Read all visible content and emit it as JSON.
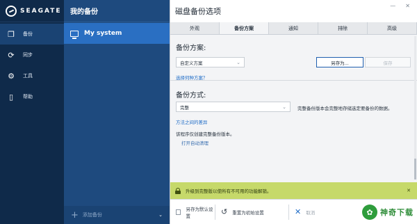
{
  "brand": {
    "name": "SEAGATE"
  },
  "sidebar": {
    "items": [
      {
        "label": "备份",
        "icon": "copy-icon",
        "active": true
      },
      {
        "label": "同步",
        "icon": "sync-icon",
        "active": false
      },
      {
        "label": "工具",
        "icon": "tools-icon",
        "active": false
      },
      {
        "label": "帮助",
        "icon": "book-icon",
        "active": false
      }
    ]
  },
  "backups": {
    "header": "我的备份",
    "items": [
      {
        "label": "My system"
      }
    ],
    "add_label": "添加备份"
  },
  "dialog": {
    "title": "磁盘备份选项",
    "tabs": [
      "外观",
      "备份方案",
      "通知",
      "排除",
      "高级"
    ],
    "active_tab": "备份方案",
    "scheme": {
      "title": "备份方案:",
      "selected": "自定义方案",
      "save_as_label": "另存为...",
      "save_label": "保存",
      "choose_link": "选择何种方案？"
    },
    "method": {
      "title": "备份方式:",
      "selected": "完整",
      "description": "完整备份版本会完整地存储选定要备份的数据。",
      "diff_link": "方法之间的差异",
      "note": "该程序仅创建完整备份版本。",
      "cleanup_link": "打开自动清理"
    },
    "upgrade": {
      "text": "升级到完整版以使所有不可用的功能解锁。",
      "close": "✕"
    },
    "bottom": {
      "save_default_label": "另存为默认设置",
      "reset_label": "重置为初始设置",
      "cancel_label": "取消"
    }
  },
  "watermark": {
    "text": "神奇下载",
    "icon": "leaf-badge-icon"
  },
  "colors": {
    "sidebar_bg": "#0f2a4a",
    "list_bg": "#1e4a7e",
    "list_active": "#2a6fc2",
    "link": "#1f6cc7",
    "upgrade_bg": "#c6d96a"
  }
}
